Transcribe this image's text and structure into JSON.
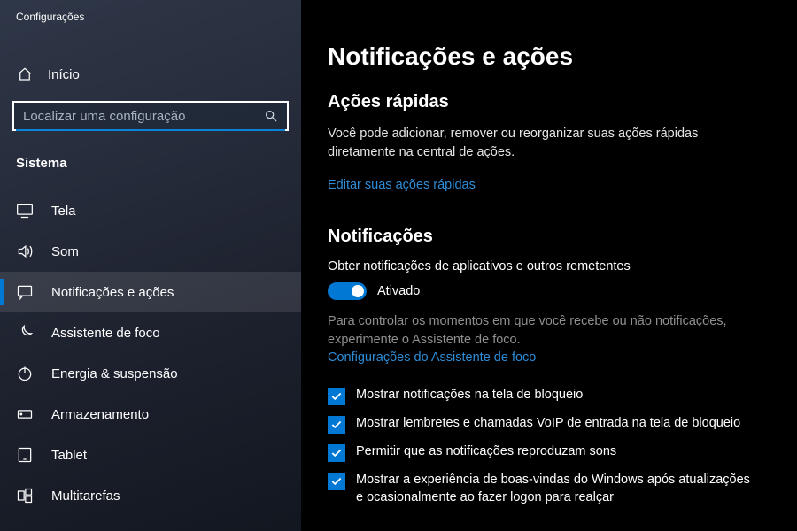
{
  "app_title": "Configurações",
  "home_label": "Início",
  "search": {
    "placeholder": "Localizar uma configuração"
  },
  "category": "Sistema",
  "nav": [
    {
      "key": "tela",
      "label": "Tela"
    },
    {
      "key": "som",
      "label": "Som"
    },
    {
      "key": "notificacoes",
      "label": "Notificações e ações"
    },
    {
      "key": "foco",
      "label": "Assistente de foco"
    },
    {
      "key": "energia",
      "label": "Energia & suspensão"
    },
    {
      "key": "armazenamento",
      "label": "Armazenamento"
    },
    {
      "key": "tablet",
      "label": "Tablet"
    },
    {
      "key": "multitarefas",
      "label": "Multitarefas"
    }
  ],
  "page": {
    "title": "Notificações e ações",
    "quick": {
      "heading": "Ações rápidas",
      "desc": "Você pode adicionar, remover ou reorganizar suas ações rápidas diretamente na central de ações.",
      "link": "Editar suas ações rápidas"
    },
    "notif": {
      "heading": "Notificações",
      "setting_label": "Obter notificações de aplicativos e outros remetentes",
      "toggle_state": "Ativado",
      "hint": "Para controlar os momentos em que você recebe ou não notificações, experimente o Assistente de foco.",
      "hint_link": "Configurações do Assistente de foco",
      "checks": [
        "Mostrar notificações na tela de bloqueio",
        "Mostrar lembretes e chamadas VoIP de entrada na tela de bloqueio",
        "Permitir que as notificações reproduzam sons",
        "Mostrar a experiência de boas-vindas do Windows após atualizações e ocasionalmente ao fazer logon para realçar"
      ]
    }
  }
}
